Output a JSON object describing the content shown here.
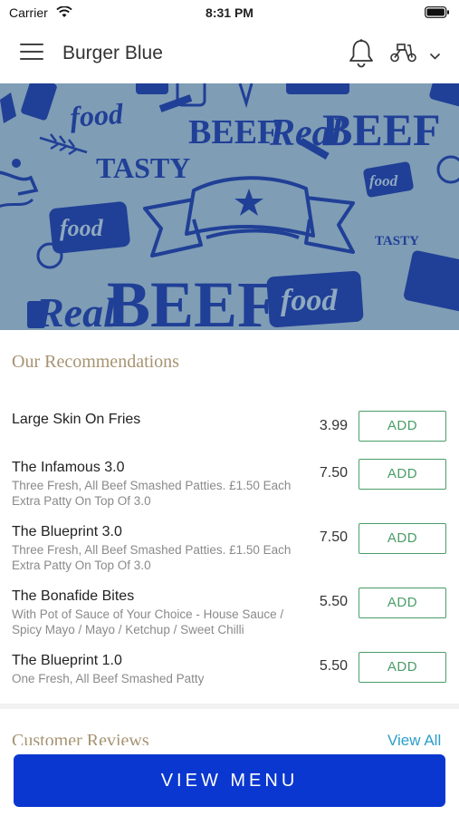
{
  "status_bar": {
    "carrier": "Carrier",
    "time": "8:31 PM"
  },
  "header": {
    "title": "Burger Blue"
  },
  "hero": {
    "words": [
      "food",
      "BEEF",
      "Real",
      "BEEF",
      "TASTY",
      "food",
      "food",
      "TASTY",
      "Real",
      "BEEF",
      "food"
    ]
  },
  "recommendations": {
    "title": "Our Recommendations",
    "add_label": "ADD",
    "items": [
      {
        "name": "Large Skin On Fries",
        "desc_line1": "",
        "desc_line2": "",
        "price": "3.99"
      },
      {
        "name": "The Infamous 3.0",
        "desc_line1": "Three Fresh, All Beef Smashed Patties. £1.50 Each",
        "desc_line2": "Extra Patty On Top Of 3.0",
        "price": "7.50"
      },
      {
        "name": "The Blueprint 3.0",
        "desc_line1": "Three Fresh, All Beef Smashed Patties. £1.50 Each",
        "desc_line2": "Extra Patty On Top Of 3.0",
        "price": "7.50"
      },
      {
        "name": "The Bonafide Bites",
        "desc_line1": "With Pot of Sauce of Your Choice - House Sauce /",
        "desc_line2": "Spicy Mayo / Mayo / Ketchup / Sweet Chilli",
        "price": "5.50"
      },
      {
        "name": "The Blueprint 1.0",
        "desc_line1": "One Fresh, All Beef Smashed Patty",
        "desc_line2": "",
        "price": "5.50"
      }
    ]
  },
  "reviews": {
    "title": "Customer Reviews",
    "view_all": "View All"
  },
  "bottom": {
    "view_menu": "VIEW MENU"
  },
  "colors": {
    "accent_green": "#4a9d68",
    "primary_blue": "#0a37cf",
    "section_gold": "#a69372",
    "link_blue": "#2a9ec9",
    "hero_bg": "#7f9db5",
    "hero_ink": "#203f96"
  }
}
